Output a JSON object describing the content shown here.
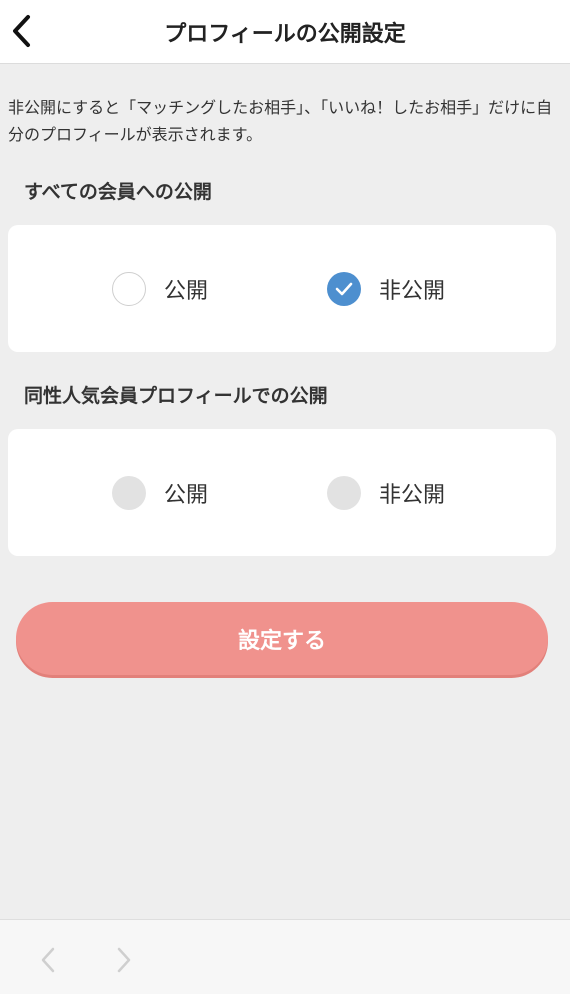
{
  "header": {
    "title": "プロフィールの公開設定",
    "back_icon": "chevron-left-icon"
  },
  "description": "非公開にすると「マッチングしたお相手」、「いいね！したお相手」だけに自分のプロフィールが表示されます。",
  "sections": [
    {
      "title": "すべての会員への公開",
      "options": [
        {
          "label": "公開",
          "state": "unselected"
        },
        {
          "label": "非公開",
          "state": "selected"
        }
      ]
    },
    {
      "title": "同性人気会員プロフィールでの公開",
      "options": [
        {
          "label": "公開",
          "state": "disabled"
        },
        {
          "label": "非公開",
          "state": "disabled"
        }
      ]
    }
  ],
  "submit_label": "設定する",
  "bottom_nav": {
    "back_icon": "chevron-left-icon",
    "forward_icon": "chevron-right-icon"
  },
  "colors": {
    "accent_check": "#4d8fcf",
    "submit_button": "#f0928d",
    "background": "#eeeeee"
  }
}
